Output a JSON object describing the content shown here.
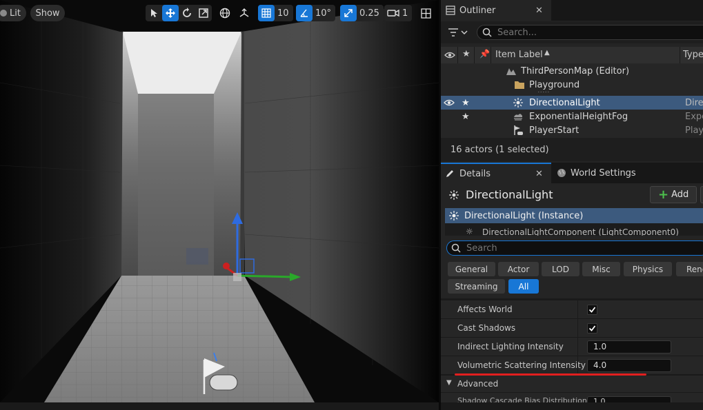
{
  "viewport": {
    "lit_label": "Lit",
    "show_label": "Show",
    "grid_snap_value": "10",
    "rotation_snap_value": "10°",
    "scale_snap_value": "0.25",
    "camera_speed_value": "1"
  },
  "outliner": {
    "tab_label": "Outliner",
    "search_placeholder": "Search...",
    "col_item_label": "Item Label",
    "col_type": "Type",
    "items": [
      {
        "label": "ThirdPersonMap (Editor)",
        "type": ""
      },
      {
        "label": "Playground",
        "type": ""
      },
      {
        "label": "DirectionalLight",
        "type": "Dire"
      },
      {
        "label": "ExponentialHeightFog",
        "type": "Expo"
      },
      {
        "label": "PlayerStart",
        "type": "Play"
      }
    ],
    "status": "16 actors (1 selected)"
  },
  "details": {
    "tab_label": "Details",
    "world_settings_label": "World Settings",
    "actor_name": "DirectionalLight",
    "add_label": "Add",
    "component_instance": "DirectionalLight (Instance)",
    "component_child": "DirectionalLightComponent (LightComponent0)",
    "search_placeholder": "Search",
    "filters": [
      "General",
      "Actor",
      "LOD",
      "Misc",
      "Physics",
      "Rend",
      "Streaming",
      "All"
    ],
    "properties": [
      {
        "label": "Affects World",
        "checked": true
      },
      {
        "label": "Cast Shadows",
        "checked": true
      },
      {
        "label": "Indirect Lighting Intensity",
        "value": "1.0"
      },
      {
        "label": "Volumetric Scattering Intensity",
        "value": "4.0"
      }
    ],
    "advanced_label": "Advanced",
    "cut_off_row_label": "Shadow Cascade Bias Distribution",
    "cut_off_row_value": "1.0"
  },
  "colors": {
    "accent": "#1877d6",
    "selection": "#3c5a7e",
    "annotation": "#e21f1f",
    "add_icon": "#4cc04c"
  }
}
